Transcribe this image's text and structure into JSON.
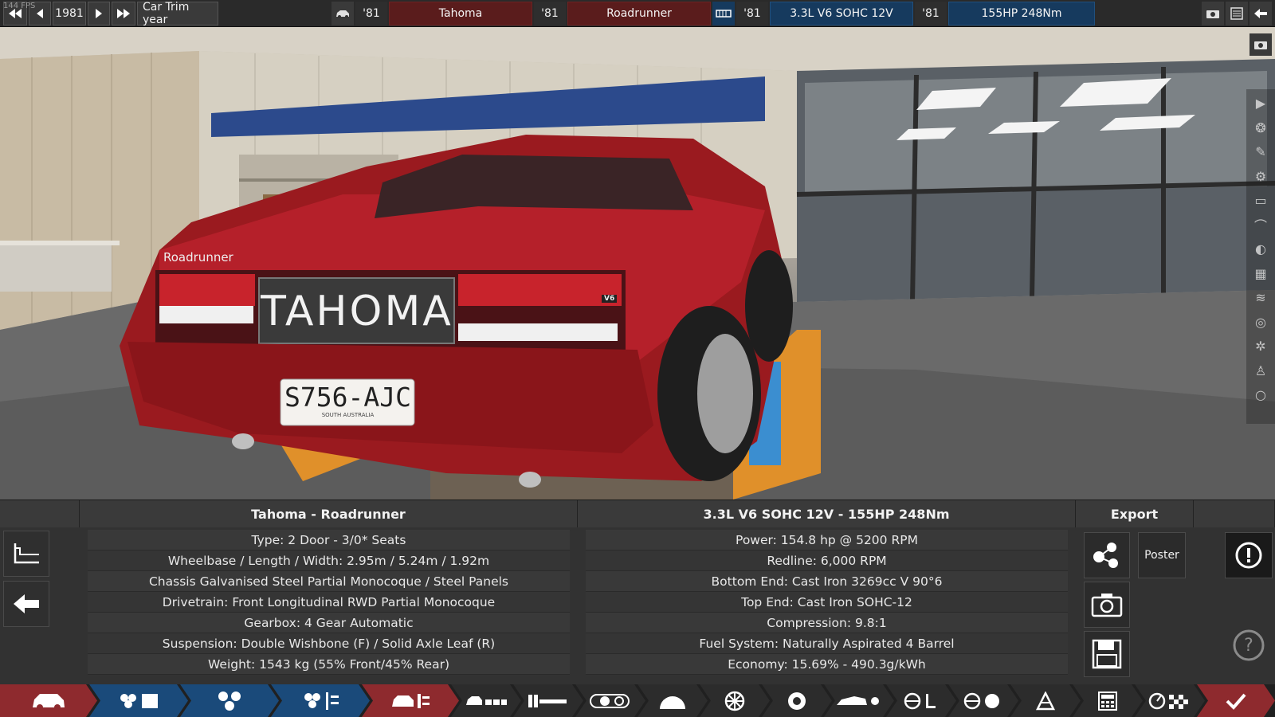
{
  "fps": "144 FPS",
  "topbar": {
    "year": "1981",
    "mode_label": "Car Trim year",
    "model_year": "'81",
    "model_name": "Tahoma",
    "trim_year": "'81",
    "trim_name": "Roadrunner",
    "engine_year": "'81",
    "engine_name": "3.3L V6 SOHC 12V",
    "variant_year": "'81",
    "variant_name": "155HP 248Nm"
  },
  "scene": {
    "badge_left": "Roadrunner",
    "badge_v6": "V6",
    "rear_name": "TAHOMA",
    "plate": "S756-AJC",
    "plate_region": "SOUTH AUSTRALIA"
  },
  "car_info": {
    "title": "Tahoma - Roadrunner",
    "rows": [
      "Type: 2 Door - 3/0* Seats",
      "Wheelbase / Length / Width: 2.95m / 5.24m / 1.92m",
      "Chassis Galvanised Steel Partial Monocoque / Steel Panels",
      "Drivetrain: Front Longitudinal RWD Partial Monocoque",
      "Gearbox: 4 Gear Automatic",
      "Suspension: Double Wishbone (F) / Solid Axle Leaf (R)",
      "Weight: 1543 kg (55% Front/45% Rear)"
    ]
  },
  "engine_info": {
    "title": "3.3L V6 SOHC 12V - 155HP 248Nm",
    "rows": [
      "Power: 154.8 hp @ 5200 RPM",
      "Redline:  6,000 RPM",
      "Bottom End: Cast Iron 3269cc V 90°6",
      "Top End: Cast Iron SOHC-12",
      "Compression: 9.8:1",
      "Fuel System: Naturally Aspirated 4 Barrel",
      "Economy: 15.69% - 490.3g/kWh"
    ]
  },
  "export": {
    "title": "Export",
    "poster_label": "Poster"
  },
  "colors": {
    "accent_red": "#b5202a",
    "tab_blue": "#1a4a7a",
    "tab_red": "#8e2a2e"
  }
}
